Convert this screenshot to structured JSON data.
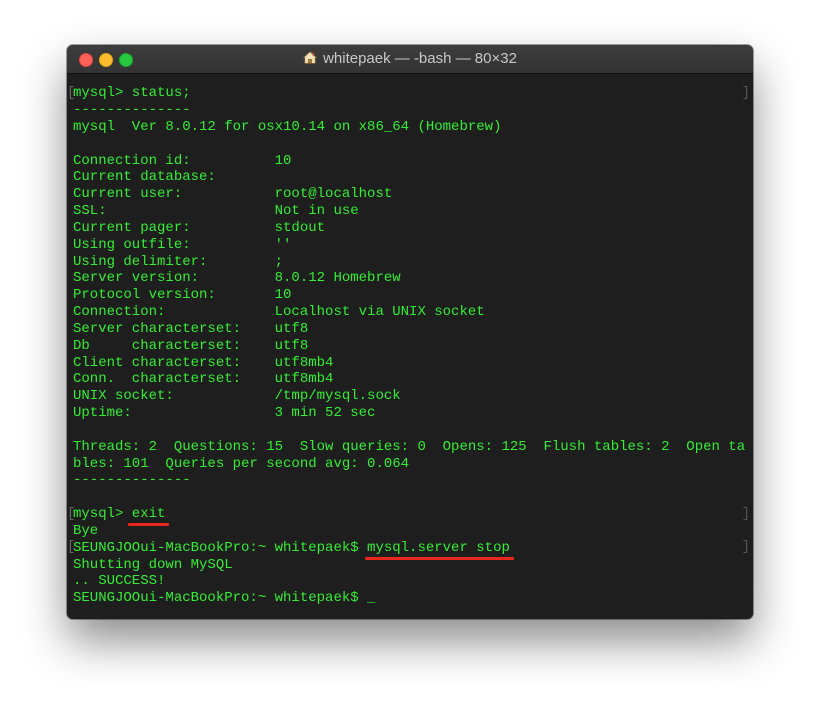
{
  "window": {
    "title": "whitepaek — -bash — 80×32",
    "title_icon": "home-icon"
  },
  "terminal": {
    "text_color": "#33ee33",
    "underline_color": "#e8261c",
    "lines": [
      "mysql> status;",
      "--------------",
      "mysql  Ver 8.0.12 for osx10.14 on x86_64 (Homebrew)",
      "",
      "Connection id:          10",
      "Current database:",
      "Current user:           root@localhost",
      "SSL:                    Not in use",
      "Current pager:          stdout",
      "Using outfile:          ''",
      "Using delimiter:        ;",
      "Server version:         8.0.12 Homebrew",
      "Protocol version:       10",
      "Connection:             Localhost via UNIX socket",
      "Server characterset:    utf8",
      "Db     characterset:    utf8",
      "Client characterset:    utf8mb4",
      "Conn.  characterset:    utf8mb4",
      "UNIX socket:            /tmp/mysql.sock",
      "Uptime:                 3 min 52 sec",
      "",
      "Threads: 2  Questions: 15  Slow queries: 0  Opens: 125  Flush tables: 2  Open ta",
      "bles: 101  Queries per second avg: 0.064",
      "--------------",
      "",
      "mysql> exit",
      "Bye",
      "SEUNGJOOui-MacBookPro:~ whitepaek$ mysql.server stop",
      "Shutting down MySQL",
      ".. SUCCESS!",
      "SEUNGJOOui-MacBookPro:~ whitepaek$ _"
    ]
  }
}
